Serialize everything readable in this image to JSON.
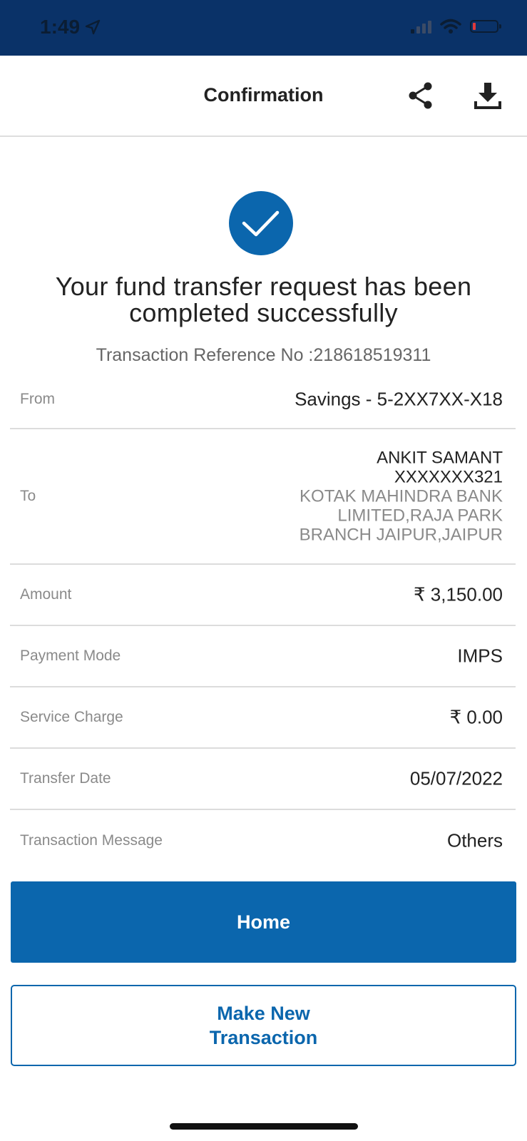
{
  "status_bar": {
    "time": "1:49",
    "background": "#0a3268"
  },
  "header": {
    "title": "Confirmation",
    "share_icon": "share-icon",
    "download_icon": "download-icon"
  },
  "success": {
    "icon": "checkmark-icon",
    "message": "Your fund transfer request has been completed successfully",
    "reference_line": "Transaction Reference No :218618519311"
  },
  "details": {
    "from": {
      "label": "From",
      "value": "Savings - 5-2XX7XX-X18"
    },
    "to": {
      "label": "To",
      "name": "ANKIT SAMANT",
      "account": "XXXXXXX321",
      "bank": "KOTAK MAHINDRA BANK LIMITED,RAJA PARK BRANCH JAIPUR,JAIPUR"
    },
    "amount": {
      "label": "Amount",
      "value": "₹ 3,150.00"
    },
    "payment_mode": {
      "label": "Payment Mode",
      "value": "IMPS"
    },
    "service_charge": {
      "label": "Service Charge",
      "value": "₹ 0.00"
    },
    "transfer_date": {
      "label": "Transfer Date",
      "value": "05/07/2022"
    },
    "transaction_message": {
      "label": "Transaction Message",
      "value": "Others"
    }
  },
  "buttons": {
    "home": "Home",
    "new_transaction": "Make New Transaction"
  },
  "colors": {
    "accent": "#0b66ad",
    "divider": "#dcdcdc",
    "label_gray": "#8a8a8a"
  }
}
